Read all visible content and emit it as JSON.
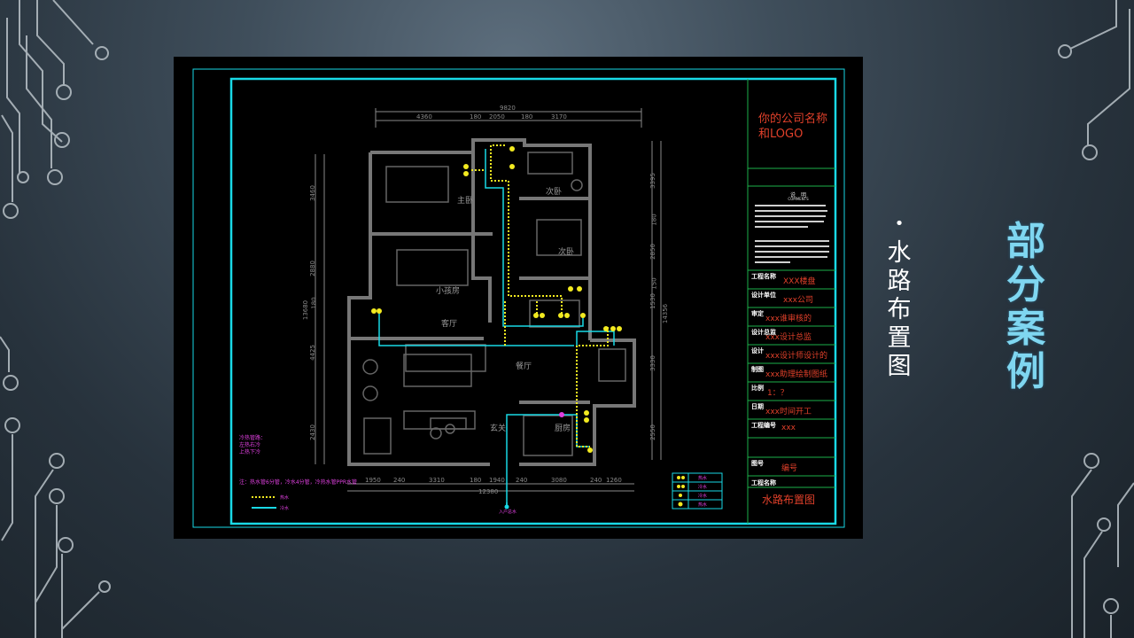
{
  "slide": {
    "title": "部分案例",
    "bullet": "水路布置图"
  },
  "drawing": {
    "company": [
      "你的公司名称",
      "和LOGO"
    ],
    "notes_heading": "说　明",
    "notes_sub": "COMMENTS",
    "fields": [
      {
        "key": "工程名称",
        "value": "XXX楼盘"
      },
      {
        "key": "设计单位",
        "value": "xxx公司"
      },
      {
        "key": "审定",
        "value": "xxx谁审核的"
      },
      {
        "key": "设计总监",
        "value": "xxx设计总监"
      },
      {
        "key": "设计",
        "value": "xxx设计师设计的"
      },
      {
        "key": "制图",
        "value": "xxx助理绘制图纸"
      },
      {
        "key": "比例",
        "value": "1：？"
      },
      {
        "key": "日期",
        "value": "xxx时间开工"
      },
      {
        "key": "工程编号",
        "value": "xxx"
      },
      {
        "key": "图号",
        "value": "编号"
      },
      {
        "key": "工程名称",
        "value": ""
      }
    ],
    "sheet_title": "水路布置图",
    "rooms": [
      "主卧",
      "次卧",
      "次卧",
      "小孩房",
      "客厅",
      "餐厅",
      "厨房",
      "玄关"
    ],
    "dims_top": [
      "9820",
      "4360",
      "180",
      "2050",
      "180",
      "3170"
    ],
    "dims_bottom": [
      "1950",
      "240",
      "3310",
      "180",
      "1940",
      "240",
      "3080",
      "240",
      "1260"
    ],
    "dim_total_bottom": "12380",
    "dims_left": [
      "3460",
      "2880",
      "180",
      "4425",
      "2430",
      "13680"
    ],
    "dims_right": [
      "3395",
      "180",
      "2850",
      "150",
      "1530",
      "14356",
      "3330",
      "2550"
    ],
    "notes_magenta": [
      "冷热管路：",
      "左热右冷",
      "上热下冷"
    ],
    "note_pipes": "注：热水管6分管，冷水4分管，冷热水管PPR水管",
    "legend_lines": [
      "热水",
      "冷水"
    ],
    "legend_box": [
      "热水",
      "冷水",
      "冷水",
      "热水"
    ],
    "entry_label": "入户总水"
  },
  "colors": {
    "cyan": "#19d9e6",
    "red": "#e0402a",
    "green": "#1db04a",
    "yellow": "#f2ea20",
    "magenta": "#e040e0",
    "title_blue": "#7fd6f0"
  }
}
